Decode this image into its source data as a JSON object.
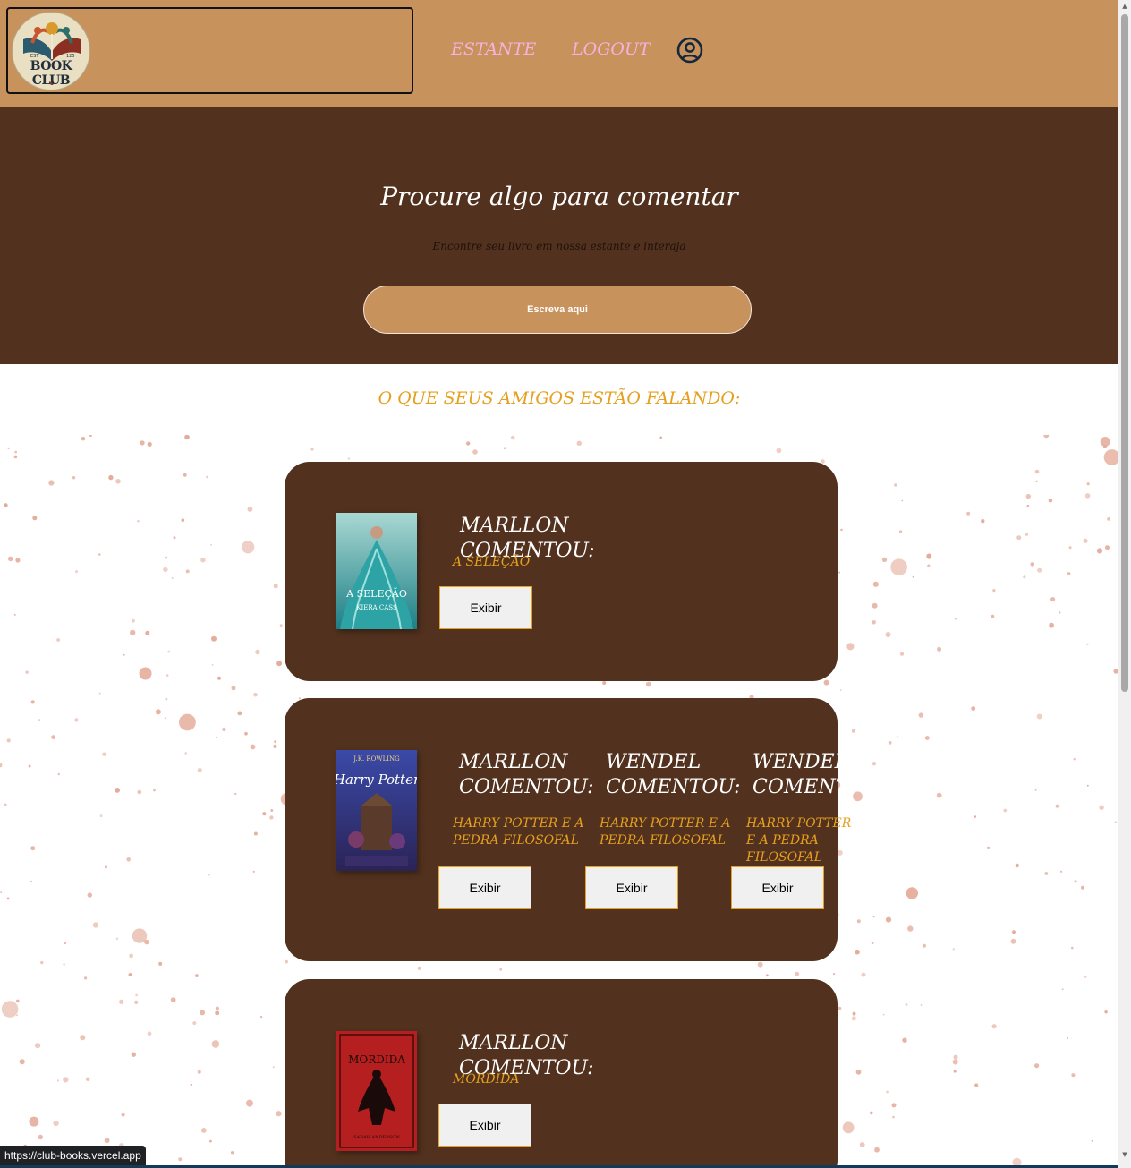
{
  "header": {
    "logo_text": "BOOK CLUB",
    "nav": [
      {
        "label": "ESTANTE"
      },
      {
        "label": "LOGOUT"
      }
    ],
    "user_icon": "user-circle-icon"
  },
  "hero": {
    "title": "Procure algo para comentar",
    "subtitle": "Encontre seu livro em nossa estante e interaja",
    "search_placeholder": "Escreva aqui"
  },
  "friends": {
    "title": "O QUE SEUS AMIGOS ESTÃO FALANDO:",
    "cards": [
      {
        "cover_title": "A SELEÇÃO",
        "cover_author": "KIERA CASS",
        "comments": [
          {
            "title": "MARLLON COMENTOU:",
            "book": "A SELEÇÃO",
            "button": "Exibir"
          }
        ]
      },
      {
        "cover_title": "Harry Potter",
        "cover_author": "J.K. ROWLING",
        "comments": [
          {
            "title": "MARLLON COMENTOU:",
            "book": "HARRY POTTER E A PEDRA FILOSOFAL",
            "button": "Exibir"
          },
          {
            "title": "WENDEL COMENTOU:",
            "book": "HARRY POTTER E A PEDRA FILOSOFAL",
            "button": "Exibir"
          },
          {
            "title": "WENDEL COMENTOU:",
            "book": "HARRY POTTER E A PEDRA FILOSOFAL",
            "button": "Exibir"
          }
        ]
      },
      {
        "cover_title": "MORDIDA",
        "cover_author": "SARAH ANDERSON",
        "comments": [
          {
            "title": "MARLLON COMENTOU:",
            "book": "MORDIDA",
            "button": "Exibir"
          }
        ]
      }
    ]
  },
  "status_bar": {
    "url": "https://club-books.vercel.app"
  },
  "colors": {
    "header": "#c8925c",
    "hero": "#52311e",
    "card": "#52311e",
    "accent": "#e5a01f",
    "nav_link": "#f2b3dc",
    "speckle": "#e4ab9a"
  }
}
